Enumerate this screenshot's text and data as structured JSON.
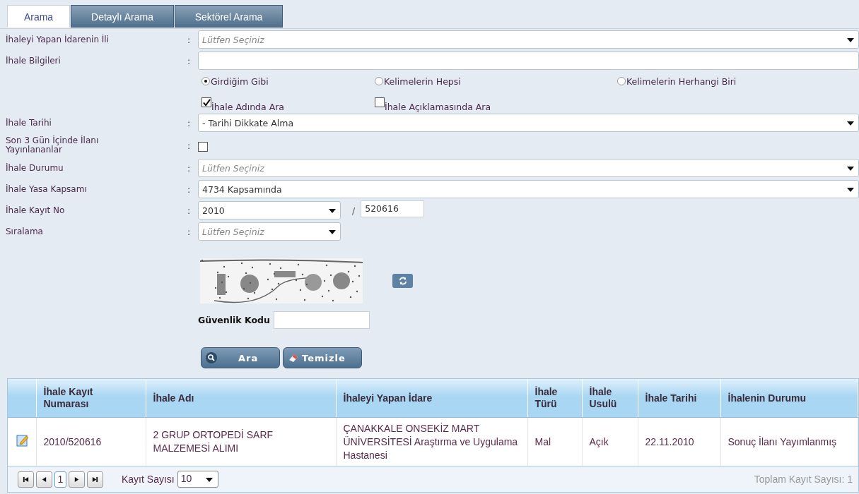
{
  "tabs": [
    {
      "label": "Arama",
      "selected": true
    },
    {
      "label": "Detaylı Arama",
      "selected": false
    },
    {
      "label": "Sektörel Arama",
      "selected": false
    }
  ],
  "form": {
    "rows": [
      {
        "kind": "select",
        "label": "İhaleyi Yapan İdarenin İli",
        "colon": ":",
        "placeholder": "Lütfen Seçiniz"
      },
      {
        "kind": "text",
        "label": "İhale Bilgileri",
        "colon": ":"
      },
      {
        "kind": "radios",
        "options": [
          {
            "label": "Girdiğim Gibi",
            "selected": true
          },
          {
            "label": "Kelimelerin Hepsi",
            "selected": false
          },
          {
            "label": "Kelimelerin Herhangi Biri",
            "selected": false
          }
        ]
      },
      {
        "kind": "checks",
        "options": [
          {
            "label": "İhale Adında Ara",
            "checked": true
          },
          {
            "label": "İhale Açıklamasında Ara",
            "checked": false
          }
        ]
      },
      {
        "kind": "select",
        "label": "İhale Tarihi",
        "colon": ":",
        "value": "- Tarihi Dikkate Alma"
      },
      {
        "kind": "checkbox",
        "label": "Son 3 Gün İçinde İlanı Yayınlananlar",
        "colon": ":",
        "checked": false
      },
      {
        "kind": "select",
        "label": "İhale Durumu",
        "colon": ":",
        "placeholder": "Lütfen Seçiniz"
      },
      {
        "kind": "select",
        "label": "İhale Yasa Kapsamı",
        "colon": ":",
        "value": "4734 Kapsamında"
      },
      {
        "kind": "record",
        "label": "İhale Kayıt No",
        "colon": ":",
        "year": "2010",
        "separator": "/",
        "number": "520616"
      },
      {
        "kind": "small-select",
        "label": "Sıralama",
        "colon": ":",
        "placeholder": "Lütfen Seçiniz"
      }
    ]
  },
  "security_code": {
    "label": "Güvenlik Kodu"
  },
  "buttons": [
    {
      "kind": "search",
      "label": "Ara"
    },
    {
      "kind": "clear",
      "label": "Temizle"
    }
  ],
  "table": {
    "columns": [
      "İhale Kayıt Numarası",
      "İhale Adı",
      "İhaleyi Yapan İdare",
      "İhale Türü",
      "İhale Usulü",
      "İhale Tarihi",
      "İhalenin Durumu"
    ],
    "rows": [
      {
        "cells": [
          "2010/520616",
          "2 GRUP ORTOPEDİ SARF MALZEMESİ ALIMI",
          "ÇANAKKALE ONSEKİZ MART ÜNİVERSİTESİ Araştırma ve Uygulama Hastanesi",
          "Mal",
          "Açık",
          "22.11.2010",
          "Sonuç İlanı Yayımlanmış"
        ]
      }
    ]
  },
  "pager": {
    "page": "1",
    "page_size_label": "Kayıt Sayısı",
    "page_size": "10",
    "total": "Toplam Kayıt Sayısı: 1"
  }
}
